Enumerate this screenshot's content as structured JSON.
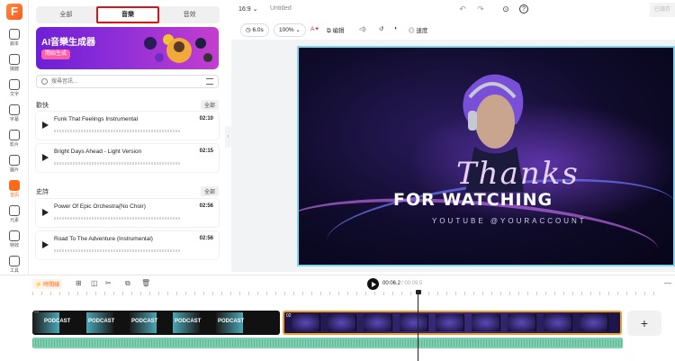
{
  "app": {
    "logo": "F"
  },
  "rail": [
    {
      "label": "劇本",
      "icon": "script-icon"
    },
    {
      "label": "媒體",
      "icon": "media-icon"
    },
    {
      "label": "文字",
      "icon": "text-icon"
    },
    {
      "label": "字幕",
      "icon": "subtitle-icon"
    },
    {
      "label": "影片",
      "icon": "video-icon"
    },
    {
      "label": "圖片",
      "icon": "image-icon"
    },
    {
      "label": "音訊",
      "icon": "music-icon"
    },
    {
      "label": "元素",
      "icon": "elements-icon"
    },
    {
      "label": "特效",
      "icon": "effects-icon"
    },
    {
      "label": "工具",
      "icon": "tools-icon"
    }
  ],
  "panel": {
    "tabs": [
      "全部",
      "音樂",
      "音效"
    ],
    "selected_tab": "音樂",
    "banner": {
      "title": "AI音樂生成器",
      "button": "開始生成"
    },
    "search": {
      "placeholder": "搜尋音訊..."
    },
    "sections": [
      {
        "title": "歡快",
        "all": "全部",
        "tracks": [
          {
            "name": "Funk That Feelings Instrumental",
            "duration": "02:10"
          },
          {
            "name": "Bright Days Ahead - Light Version",
            "duration": "02:15"
          }
        ]
      },
      {
        "title": "史詩",
        "all": "全部",
        "tracks": [
          {
            "name": "Power Of Epic Orchestra(No Choir)",
            "duration": "02:56"
          },
          {
            "name": "Road To The Adventure (Instrumental)",
            "duration": "02:56"
          }
        ]
      }
    ]
  },
  "topbar": {
    "ratio": "16:9 ⌄",
    "title": "Untitled",
    "export": "已儲存"
  },
  "toolbar": {
    "duration": "6.0s",
    "zoom": "100%",
    "edit": "编辑",
    "speed": "速度"
  },
  "canvas": {
    "thanks": "Thanks",
    "for_watching": "FOR WATCHING",
    "youtube": "YOUTUBE @YOURACCOUNT"
  },
  "timeline": {
    "badge": "⚡ 時間線",
    "current": "00:06.2",
    "total": "/ 00:09.5",
    "clip1_label": "PODCAST",
    "clip1_num": "01",
    "clip2_num": "02",
    "add": "+"
  },
  "colors": {
    "accent": "#ff6a1a",
    "selection": "#d9141b",
    "audio": "#7ecfb0",
    "clip_border": "#f29b2c"
  }
}
